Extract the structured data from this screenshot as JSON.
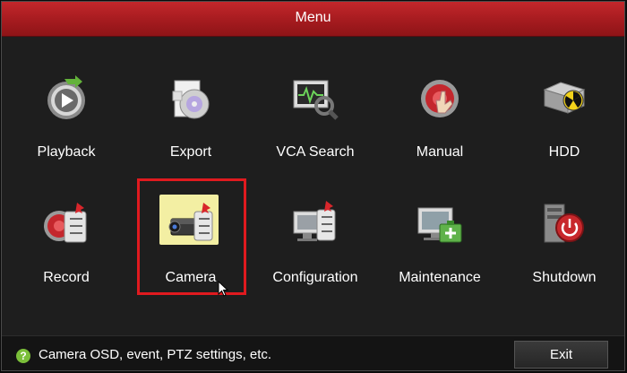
{
  "window": {
    "title": "Menu"
  },
  "menu": {
    "items": [
      {
        "label": "Playback",
        "icon": "playback-icon"
      },
      {
        "label": "Export",
        "icon": "export-disc-icon"
      },
      {
        "label": "VCA Search",
        "icon": "vca-search-icon"
      },
      {
        "label": "Manual",
        "icon": "manual-record-icon"
      },
      {
        "label": "HDD",
        "icon": "hdd-icon"
      },
      {
        "label": "Record",
        "icon": "record-icon"
      },
      {
        "label": "Camera",
        "icon": "camera-icon",
        "selected": true
      },
      {
        "label": "Configuration",
        "icon": "configuration-icon"
      },
      {
        "label": "Maintenance",
        "icon": "maintenance-icon"
      },
      {
        "label": "Shutdown",
        "icon": "shutdown-icon"
      }
    ]
  },
  "status": {
    "icon": "help-icon",
    "text": "Camera OSD, event, PTZ settings, etc.",
    "exit_label": "Exit"
  },
  "colors": {
    "title_bar": "#b01f23",
    "selection_border": "#e01a1f",
    "background": "#1e1e1e"
  }
}
